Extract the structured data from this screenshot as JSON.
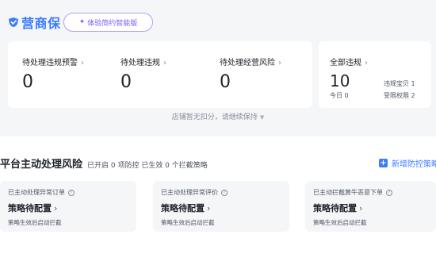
{
  "header": {
    "brand_name": "营商保",
    "trial_label": "体验简约智能版"
  },
  "violations": {
    "metrics": [
      {
        "label": "待处理违规预警",
        "value": "0"
      },
      {
        "label": "待处理违规",
        "value": "0"
      },
      {
        "label": "待处理经营风险",
        "value": "0"
      }
    ],
    "all": {
      "label": "全部违规",
      "value": "10",
      "today": "今日 0",
      "details": [
        "违规宝贝 1",
        "受限权限 2"
      ]
    },
    "score_note": "店铺暂无扣分，请继续保持"
  },
  "risk_section": {
    "title": "平台主动处理风险",
    "description": "已开启 0 项防控 已生效 0 个拦截策略",
    "add_button": "新增防控策略",
    "cards": [
      {
        "label": "已主动处理异常订单",
        "status": "策略待配置",
        "note": "策略生效后启动拦截"
      },
      {
        "label": "已主动处理异常评价",
        "status": "策略待配置",
        "note": "策略生效后启动拦截"
      },
      {
        "label": "已主动拦截黄牛恶意下单",
        "status": "策略待配置",
        "note": "策略生效后启动拦截"
      }
    ]
  },
  "colors": {
    "brand_blue": "#3a7bff",
    "trial_purple": "#7b5cff",
    "panel_bg": "#f5f6f8"
  },
  "icons": {
    "logo": "shield-logo-icon",
    "trial": "sparkle-icon",
    "chevron": "chevron-right-icon",
    "add": "plus-square-icon",
    "help": "question-circle-icon",
    "score_toggle": "triangle-down-icon"
  }
}
